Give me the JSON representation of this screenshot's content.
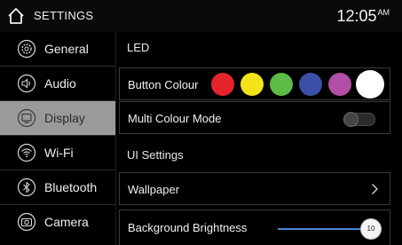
{
  "header": {
    "title": "SETTINGS",
    "time": "12:05",
    "ampm": "AM"
  },
  "sidebar": {
    "items": [
      {
        "label": "General",
        "icon": "gear-icon",
        "active": false
      },
      {
        "label": "Audio",
        "icon": "speaker-icon",
        "active": false
      },
      {
        "label": "Display",
        "icon": "display-icon",
        "active": true
      },
      {
        "label": "Wi-Fi",
        "icon": "wifi-icon",
        "active": false
      },
      {
        "label": "Bluetooth",
        "icon": "bluetooth-icon",
        "active": false
      },
      {
        "label": "Camera",
        "icon": "camera-icon",
        "active": false
      }
    ]
  },
  "main": {
    "led_section": "LED",
    "button_colour_label": "Button Colour",
    "colours": [
      "#e6242b",
      "#f2e31a",
      "#5dbb47",
      "#3b4fa6",
      "#b24ea6",
      "#ffffff"
    ],
    "selected_colour": "#ffffff",
    "multi_colour_label": "Multi Colour Mode",
    "multi_colour_on": false,
    "ui_section": "UI Settings",
    "wallpaper_label": "Wallpaper",
    "brightness_label": "Background Brightness",
    "brightness_value": "10",
    "brightness_fraction": 1.0
  }
}
